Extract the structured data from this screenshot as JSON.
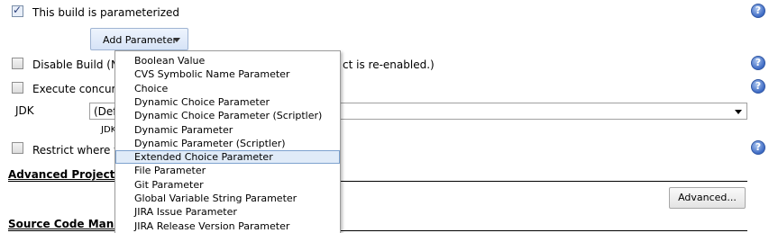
{
  "parameterized": {
    "label": "This build is parameterized",
    "checked": true
  },
  "add_parameter": {
    "label": "Add Parameter"
  },
  "disable_build": {
    "label": "Disable Build (N",
    "label_tail": "ct is re-enabled.)",
    "checked": false
  },
  "execute_concurrent": {
    "label": "Execute concurr",
    "checked": false
  },
  "jdk": {
    "label": "JDK",
    "selected_value": "(Def",
    "hint": "JDK to"
  },
  "restrict": {
    "label": "Restrict where th",
    "checked": false
  },
  "sections": {
    "advanced_project": "Advanced Project",
    "source_code": "Source Code Mana"
  },
  "advanced_button": {
    "label": "Advanced..."
  },
  "help_icon_glyph": "?",
  "menu": {
    "items": [
      "Boolean Value",
      "CVS Symbolic Name Parameter",
      "Choice",
      "Dynamic Choice Parameter",
      "Dynamic Choice Parameter (Scriptler)",
      "Dynamic Parameter",
      "Dynamic Parameter (Scriptler)",
      "Extended Choice Parameter",
      "File Parameter",
      "Git Parameter",
      "Global Variable String Parameter",
      "JIRA Issue Parameter",
      "JIRA Release Version Parameter"
    ],
    "selected_index": 7
  },
  "colors": {
    "accent": "#3d6ac4",
    "menu_highlight": "#e0ebf8"
  }
}
